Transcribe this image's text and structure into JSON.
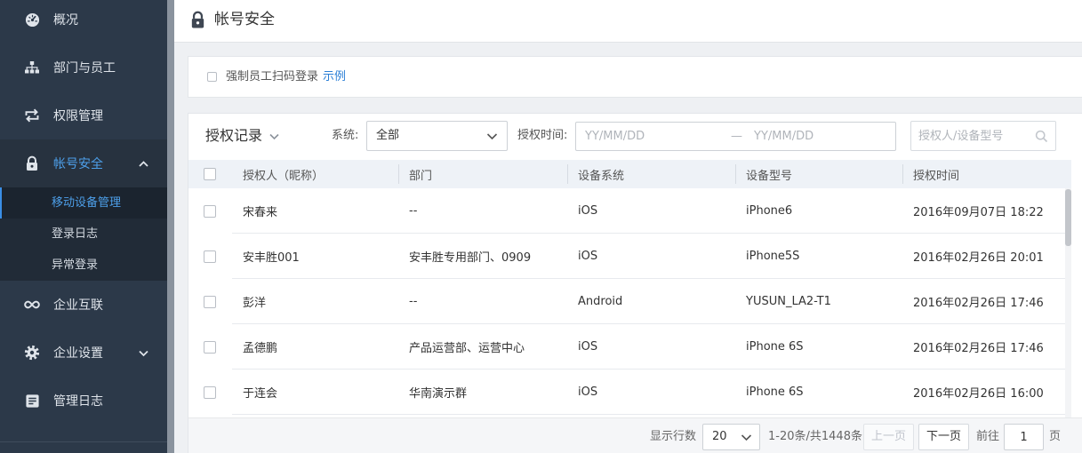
{
  "colors": {
    "sidebar_bg": "#2c3949",
    "accent": "#4d9fe9",
    "link": "#2b7fd6",
    "page_bg": "#eef0f3",
    "table_header_bg": "#eef2f7"
  },
  "sidebar": {
    "items": [
      {
        "label": "概况",
        "icon": "dashboard-icon"
      },
      {
        "label": "部门与员工",
        "icon": "org-chart-icon"
      },
      {
        "label": "权限管理",
        "icon": "swap-arrows-icon"
      },
      {
        "label": "帐号安全",
        "icon": "lock-icon",
        "state_icon": "chevron-up-icon",
        "submenu": [
          {
            "label": "移动设备管理",
            "active": true
          },
          {
            "label": "登录日志"
          },
          {
            "label": "异常登录"
          }
        ]
      },
      {
        "label": "企业互联",
        "icon": "infinity-icon"
      },
      {
        "label": "企业设置",
        "icon": "gear-icon",
        "state_icon": "chevron-down-icon"
      },
      {
        "label": "管理日志",
        "icon": "log-icon"
      }
    ]
  },
  "header": {
    "icon": "lock-icon",
    "title": "帐号安全"
  },
  "scan_login": {
    "checked": false,
    "label": "强制员工扫码登录",
    "example_link": "示例"
  },
  "records": {
    "title": "授权记录",
    "title_icon": "chevron-down-icon",
    "filters": {
      "system_label": "系统:",
      "system_value": "全部",
      "time_label": "授权时间:",
      "date_start_placeholder": "YY/MM/DD",
      "date_separator": "—",
      "date_end_placeholder": "YY/MM/DD",
      "search_placeholder": "授权人/设备型号",
      "search_icon": "search-icon"
    },
    "columns": [
      "授权人（昵称）",
      "部门",
      "设备系统",
      "设备型号",
      "授权时间"
    ],
    "rows": [
      [
        "宋春来",
        "--",
        "iOS",
        "iPhone6",
        "2016年09月07日 18:22"
      ],
      [
        "安丰胜001",
        "安丰胜专用部门、0909",
        "iOS",
        "iPhone5S",
        "2016年02月26日 20:01"
      ],
      [
        "彭洋",
        "--",
        "Android",
        "YUSUN_LA2-T1",
        "2016年02月26日 17:46"
      ],
      [
        "孟德鹏",
        "产品运营部、运营中心",
        "iOS",
        "iPhone 6S",
        "2016年02月26日 17:46"
      ],
      [
        "于连会",
        "华南演示群",
        "iOS",
        "iPhone 6S",
        "2016年02月26日 16:00"
      ]
    ],
    "pagination": {
      "rows_label": "显示行数",
      "page_size": "20",
      "range_text": "1-20条/共1448条",
      "prev_label": "上一页",
      "next_label": "下一页",
      "goto_label": "前往",
      "page_input": "1",
      "page_unit": "页"
    }
  }
}
